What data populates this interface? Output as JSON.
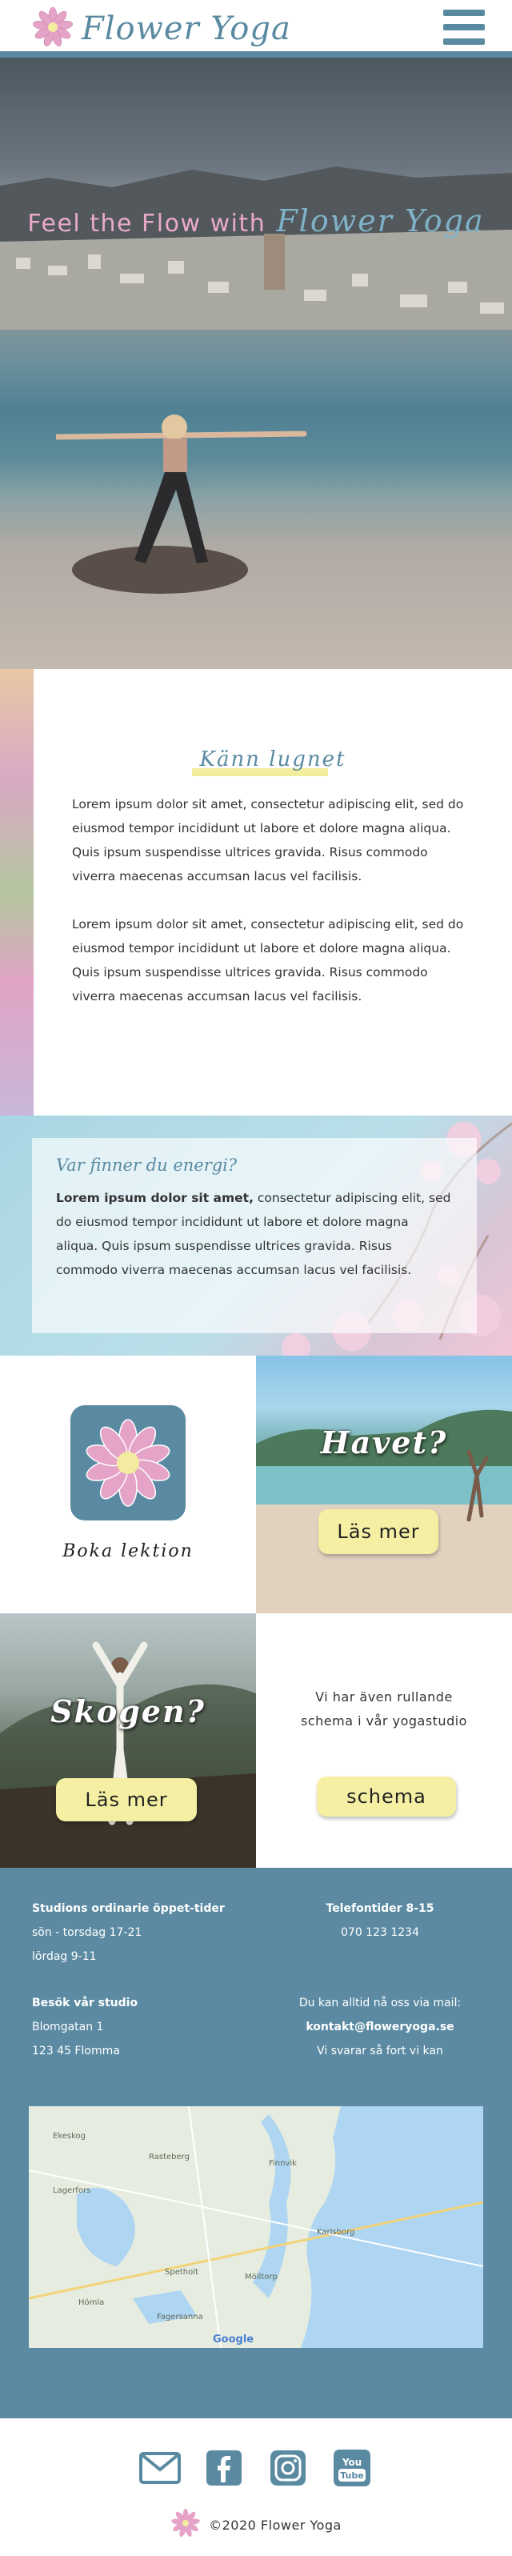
{
  "header": {
    "logo_text": "Flower Yoga",
    "menu_icon": "hamburger-menu-icon"
  },
  "hero": {
    "title_part1": "Feel the Flow with",
    "title_part2": "Flower Yoga"
  },
  "intro": {
    "heading": "Känn lugnet",
    "paragraphs": [
      "Lorem ipsum dolor sit amet, consectetur adipiscing elit, sed do eiusmod tempor incididunt ut labore et dolore magna aliqua. Quis ipsum suspendisse ultrices gravida. Risus commodo viverra maecenas accumsan lacus vel facilisis.",
      "Lorem ipsum dolor sit amet, consectetur adipiscing elit, sed do eiusmod tempor incididunt ut labore et dolore magna aliqua. Quis ipsum suspendisse ultrices gravida. Risus commodo viverra maecenas accumsan lacus vel facilisis."
    ]
  },
  "energy": {
    "heading": "Var finner du energi?",
    "bold_lead": "Lorem ipsum dolor sit amet,",
    "body": " consectetur adipiscing elit, sed do eiusmod tempor incididunt ut labore et dolore magna aliqua. Quis ipsum suspendisse ultrices gravida. Risus commodo viverra maecenas accumsan lacus vel facilisis."
  },
  "tiles": {
    "book_label": "Boka lektion",
    "havet_title": "Havet?",
    "havet_button": "Läs mer",
    "skogen_title": "Skogen?",
    "skogen_button": "Läs mer",
    "schema_line1": "Vi har även rullande",
    "schema_line2": "schema i vår yogastudio",
    "schema_button": "schema"
  },
  "info": {
    "hours_title": "Studions ordinarie öppet-tider",
    "hours_line1": "sön - torsdag 17-21",
    "hours_line2": "lördag 9-11",
    "phone_title": "Telefontider 8-15",
    "phone_number": "070 123 1234",
    "visit_title": "Besök vår studio",
    "visit_street": "Blomgatan 1",
    "visit_city": "123 45 Flomma",
    "mail_line1": "Du kan alltid nå oss via mail:",
    "mail_address": "kontakt@floweryoga.se",
    "mail_line3": "Vi svarar så fort vi kan"
  },
  "map": {
    "labels": [
      "Ekeskog",
      "Rasteberg",
      "Lagerfors",
      "Finnvik",
      "Karlsborg",
      "Spetholt",
      "Mölltorp",
      "Hömla",
      "Fagersanna"
    ],
    "attribution": "Google"
  },
  "footer": {
    "social_icons": [
      "mail-icon",
      "facebook-icon",
      "instagram-icon",
      "youtube-icon"
    ],
    "youtube_you": "You",
    "youtube_tube": "Tube",
    "copyright": "©2020 Flower Yoga"
  },
  "colors": {
    "brand_blue": "#5a8aa1",
    "button_yellow": "#f4efa3",
    "pink": "#e9aac8"
  }
}
